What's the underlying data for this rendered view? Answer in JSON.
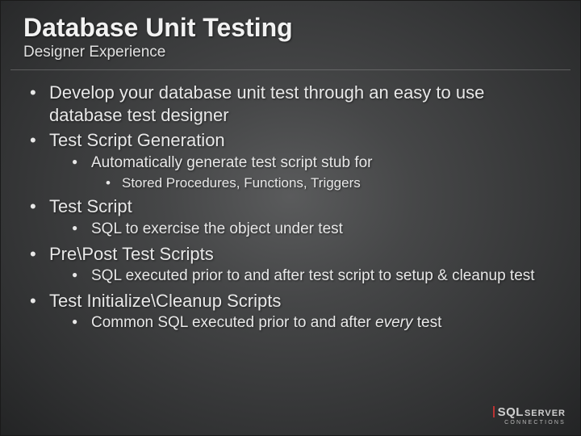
{
  "title": "Database Unit Testing",
  "subtitle": "Designer Experience",
  "bullets": {
    "b1": "Develop your database unit test through an easy to use database test designer",
    "b2": "Test Script Generation",
    "b2_1": "Automatically generate test script stub for",
    "b2_1_1": "Stored Procedures, Functions, Triggers",
    "b3": "Test Script",
    "b3_1": "SQL to exercise the object under test",
    "b4": "Pre\\Post Test Scripts",
    "b4_1": "SQL executed prior to and after test script to setup & cleanup test",
    "b5": "Test Initialize\\Cleanup Scripts",
    "b5_1_pre": "Common SQL executed prior to and after ",
    "b5_1_em": "every",
    "b5_1_post": " test"
  },
  "logo": {
    "sql": "SQL",
    "server": "SERVER",
    "tag": "CONNECTIONS"
  }
}
